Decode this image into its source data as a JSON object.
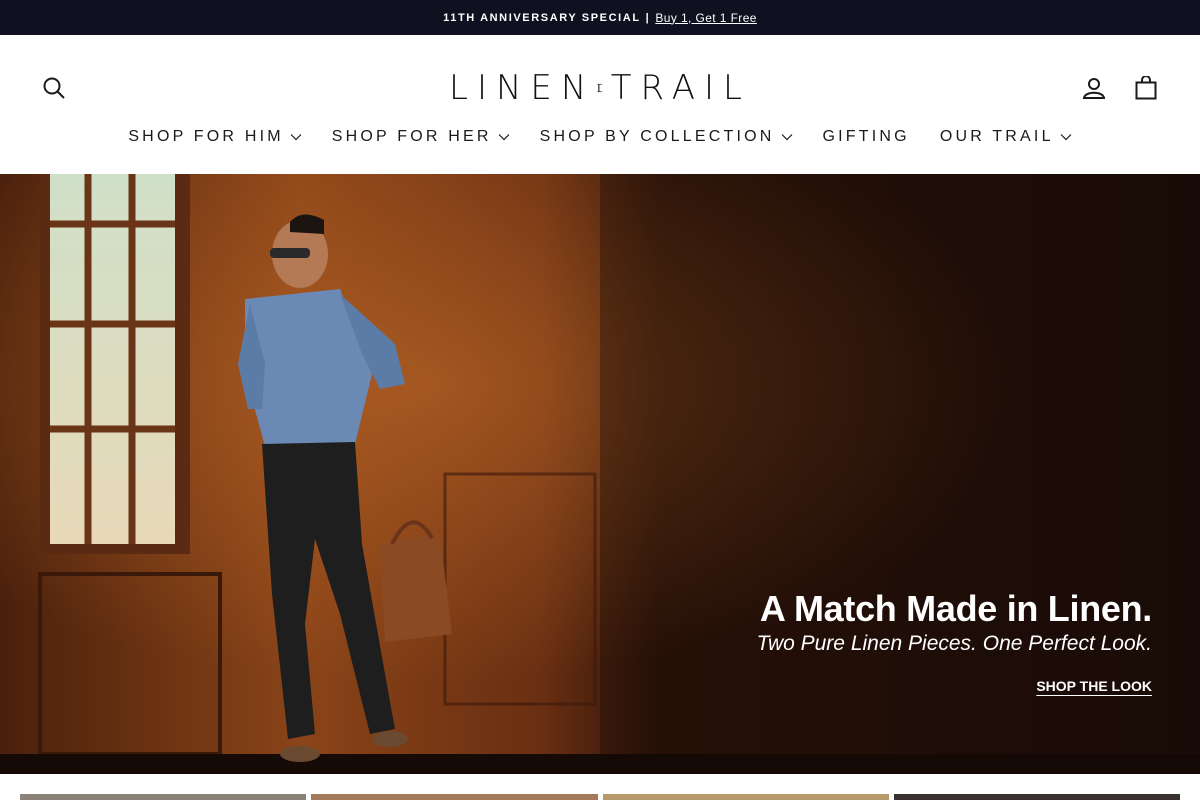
{
  "announcement": {
    "label": "11TH ANNIVERSARY SPECIAL",
    "separator": "|",
    "link": "Buy 1, Get 1 Free"
  },
  "brand": {
    "left": "LINEN",
    "right": "TRAIL",
    "name": "LINEN TRAIL"
  },
  "icons": {
    "search": "search-icon",
    "account": "account-icon",
    "cart": "shopping-bag-icon"
  },
  "nav": {
    "items": [
      {
        "label": "SHOP FOR HIM",
        "has_dropdown": true
      },
      {
        "label": "SHOP FOR HER",
        "has_dropdown": true
      },
      {
        "label": "SHOP BY COLLECTION",
        "has_dropdown": true
      },
      {
        "label": "GIFTING",
        "has_dropdown": false
      },
      {
        "label": "OUR TRAIL",
        "has_dropdown": true
      }
    ]
  },
  "hero": {
    "title": "A Match Made in Linen.",
    "subtitle": "Two Pure Linen Pieces. One Perfect Look.",
    "cta": "SHOP THE LOOK"
  },
  "colors": {
    "announcement_bg": "#0f1020",
    "text": "#1a1a1a",
    "hero_text": "#ffffff"
  }
}
